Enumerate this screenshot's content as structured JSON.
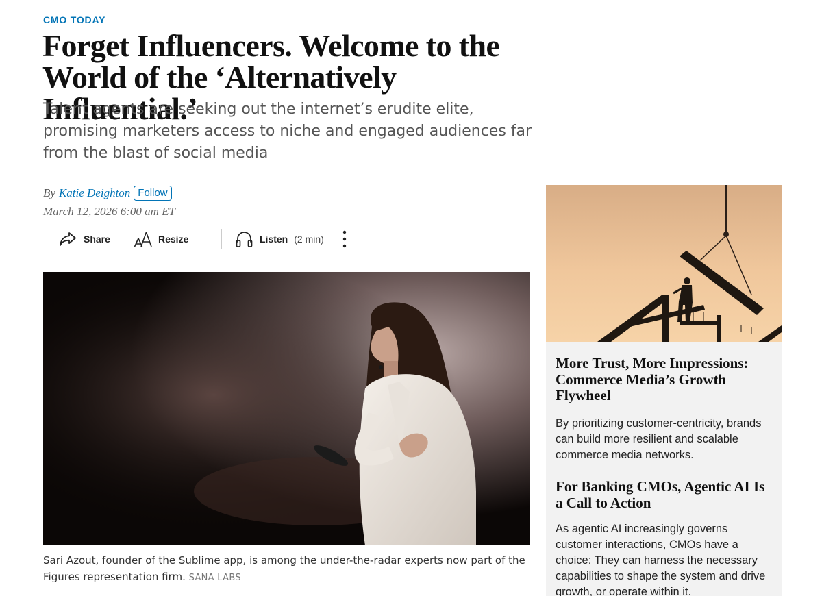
{
  "section": {
    "label": "CMO TODAY"
  },
  "article": {
    "headline": "Forget Influencers. Welcome to the World of the ‘Alternatively Influential.’",
    "dek": "Talent agents are seeking out the internet’s erudite elite, promising marketers access to niche and engaged audiences far from the blast of social media",
    "byline_prefix": "By",
    "author": "Katie Deighton",
    "follow_label": "Follow",
    "dateline": "March 12, 2026 6:00 am ET"
  },
  "toolbar": {
    "share_label": "Share",
    "resize_label": "Resize",
    "listen_label": "Listen",
    "listen_duration": "(2 min)",
    "more_icon": "vertical-dots-icon"
  },
  "photo": {
    "caption": "Sari Azout, founder of the Sublime app, is among the under-the-radar experts now part of the Figures representation firm.",
    "credit": "SANA LABS"
  },
  "sidebar": {
    "promos": [
      {
        "title": "More Trust, More Impressions: Commerce Media’s Growth Flywheel",
        "body": "By prioritizing customer-centricity, brands can build more resilient and scalable commerce media networks."
      },
      {
        "title": "For Banking CMOs, Agentic AI Is a Call to Action",
        "body": "As agentic AI increasingly governs customer interactions, CMOs have a choice: They can harness the necessary capabilities to shape the system and drive growth, or operate within it."
      }
    ]
  },
  "colors": {
    "accent": "#0274b6",
    "dek": "#555555",
    "sidebar_bg": "#f2f2f2"
  }
}
